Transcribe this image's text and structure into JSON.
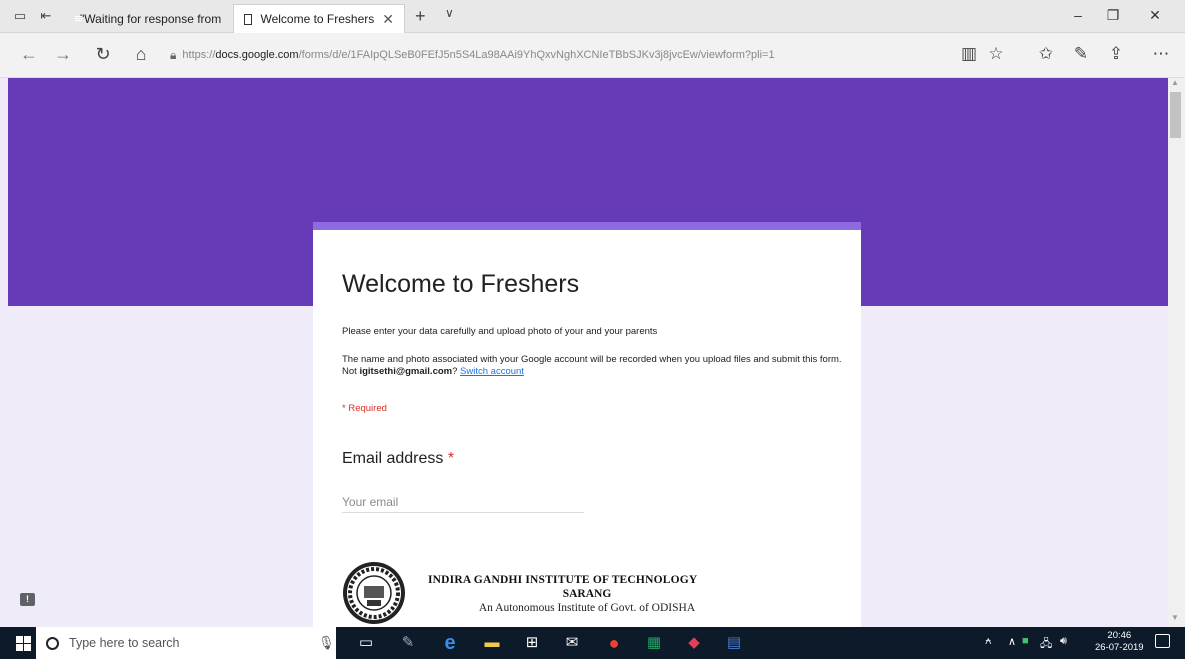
{
  "browser": {
    "tabs": [
      {
        "label": "\"Waiting for response from",
        "active": false
      },
      {
        "label": "Welcome to Freshers",
        "active": true
      }
    ],
    "url_prefix": "https://",
    "url_host": "docs.google.com",
    "url_path": "/forms/d/e/1FAIpQLSeB0FEfJ5n5S4La98AAi9YhQxvNghXCNIeTBbSJKv3j8jvcEw/viewform?pli=1",
    "window_controls": {
      "minimize": "–",
      "maximize": "❐",
      "close": "✕"
    }
  },
  "form": {
    "title": "Welcome to Freshers",
    "description": "Please enter your data carefully and upload photo of your and your parents",
    "note_prefix": "The name and photo associated with your Google account will be recorded when you upload files and submit this form. Not ",
    "account_email": "igitsethi@gmail.com",
    "note_suffix": "? ",
    "switch_account_label": "Switch account",
    "required_note": "* Required",
    "question_email_label": "Email address",
    "required_star": "*",
    "email_placeholder": "Your email",
    "institute": {
      "name": "INDIRA GANDHI INSTITUTE OF TECHNOLOGY",
      "place": "SARANG",
      "subtitle": "An Autonomous Institute of Govt. of ODISHA"
    }
  },
  "taskbar": {
    "search_placeholder": "Type here to search",
    "time": "20:46",
    "date": "26-07-2019"
  },
  "colors": {
    "brand_purple": "#673ab7",
    "page_background": "#f0ebf8",
    "required_red": "#d93025",
    "link_blue": "#1a73e8"
  }
}
